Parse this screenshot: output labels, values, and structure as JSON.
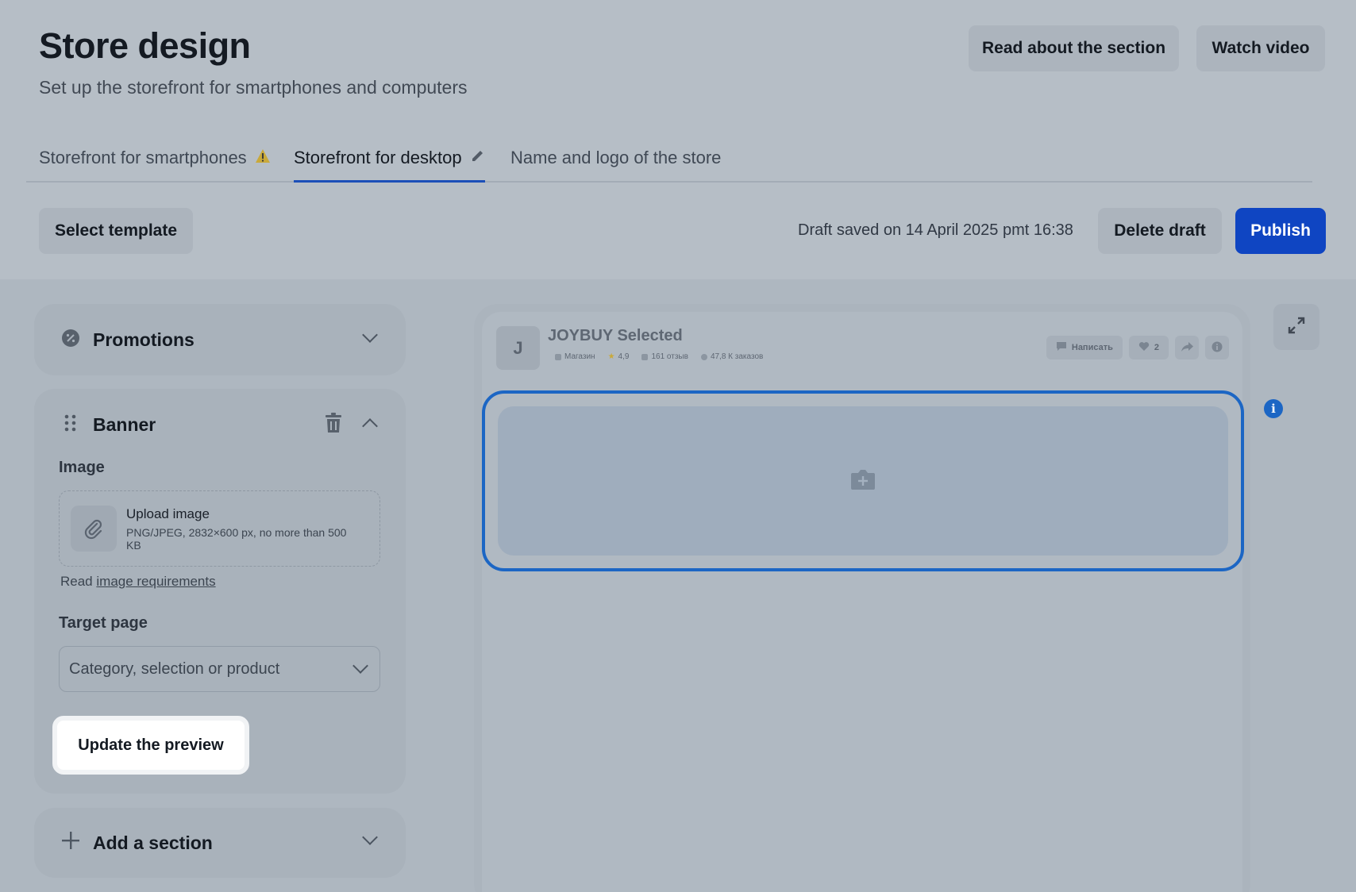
{
  "header": {
    "title": "Store design",
    "subtitle": "Set up the storefront for smartphones and computers",
    "read_button": "Read about the section",
    "video_button": "Watch video"
  },
  "tabs": [
    {
      "label": "Storefront for smartphones",
      "icon": "warning-icon"
    },
    {
      "label": "Storefront for desktop",
      "icon": "pencil-icon",
      "active": true
    },
    {
      "label": "Name and logo of the store"
    }
  ],
  "toolbar": {
    "select_template": "Select template",
    "draft_status": "Draft saved on 14 April 2025 pmt 16:38",
    "delete_draft": "Delete draft",
    "publish": "Publish"
  },
  "sidebar": {
    "promotions": {
      "title": "Promotions",
      "icon": "percent-badge-icon"
    },
    "banner": {
      "title": "Banner",
      "image_label": "Image",
      "upload_title": "Upload image",
      "upload_hint": "PNG/JPEG, 2832×600 px, no more than 500 KB",
      "requirements_prefix": "Read",
      "requirements_link": "image requirements",
      "target_label": "Target page",
      "target_placeholder": "Category, selection or product",
      "update_button": "Update the preview"
    },
    "add_section": {
      "title": "Add a section"
    }
  },
  "preview": {
    "shop_initial": "J",
    "shop_name": "JOYBUY Selected",
    "meta_type": "Магазин",
    "meta_rating": "4,9",
    "meta_reviews": "161 отзыв",
    "meta_orders": "47,8 К заказов",
    "action_write": "Написать",
    "action_likes": "2"
  },
  "colors": {
    "accent": "#0f45c2",
    "selection_border": "#1c66c4",
    "warning": "#c9a93a"
  }
}
